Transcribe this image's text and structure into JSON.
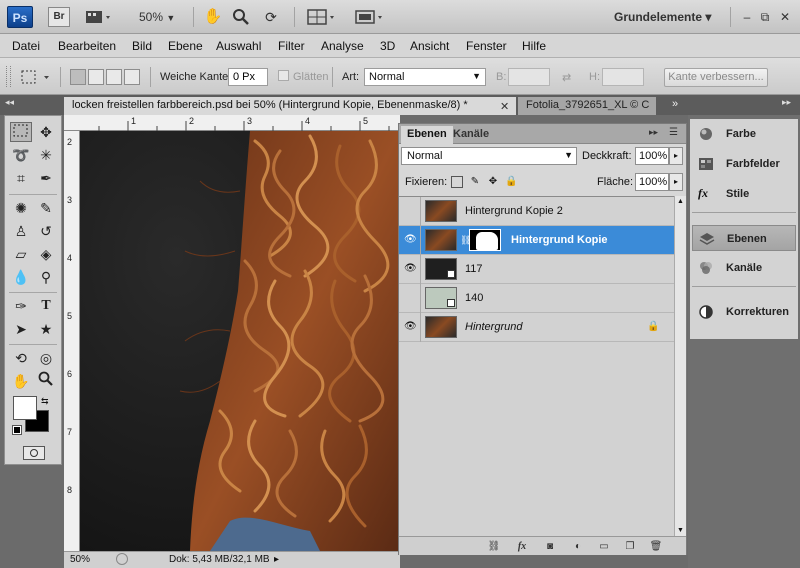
{
  "appbar": {
    "logo": "Ps",
    "bridge": "Br",
    "zoom": "50%",
    "workspace": "Grundelemente",
    "workspace_arrow": "▾",
    "minimize": "–",
    "restore": "⧉",
    "close": "✕"
  },
  "menu": [
    "Datei",
    "Bearbeiten",
    "Bild",
    "Ebene",
    "Auswahl",
    "Filter",
    "Analyse",
    "3D",
    "Ansicht",
    "Fenster",
    "Hilfe"
  ],
  "options": {
    "feather_label": "Weiche Kante:",
    "feather_value": "0 Px",
    "antialias_label": "Glätten",
    "style_label": "Art:",
    "style_value": "Normal",
    "width_label": "B:",
    "height_label": "H:",
    "refine_button": "Kante verbessern..."
  },
  "tabs": {
    "active": "locken freistellen farbbereich.psd bei 50% (Hintergrund Kopie, Ebenenmaske/8) *",
    "inactive": "Fotolia_3792651_XL © C",
    "close": "✕",
    "overflow": "»"
  },
  "ruler": {
    "top": [
      "1",
      "2",
      "3",
      "4",
      "5"
    ],
    "left": [
      "2",
      "3",
      "4",
      "5",
      "6",
      "7",
      "8"
    ]
  },
  "status": {
    "zoom": "50%",
    "doc": "Dok: 5,43 MB/32,1 MB",
    "arrow": "▸"
  },
  "layers": {
    "tab_layers": "Ebenen",
    "tab_channels": "Kanäle",
    "blend_mode": "Normal",
    "opacity_label": "Deckkraft:",
    "opacity_value": "100%",
    "lock_label": "Fixieren:",
    "fill_label": "Fläche:",
    "fill_value": "100%",
    "rows": [
      {
        "name": "Hintergrund Kopie 2",
        "visible": false,
        "selected": false
      },
      {
        "name": "Hintergrund Kopie",
        "visible": true,
        "selected": true
      },
      {
        "name": "117",
        "visible": true,
        "selected": false
      },
      {
        "name": "140",
        "visible": false,
        "selected": false
      },
      {
        "name": "Hintergrund",
        "visible": true,
        "selected": false
      }
    ]
  },
  "dock": {
    "items": [
      "Farbe",
      "Farbfelder",
      "Stile",
      "Ebenen",
      "Kanäle",
      "Korrekturen"
    ]
  },
  "colors": {
    "selection_blue": "#3b8bd8",
    "hair_dark": "#5a2a14",
    "hair_mid": "#9a4f25",
    "hair_light": "#c98445"
  }
}
